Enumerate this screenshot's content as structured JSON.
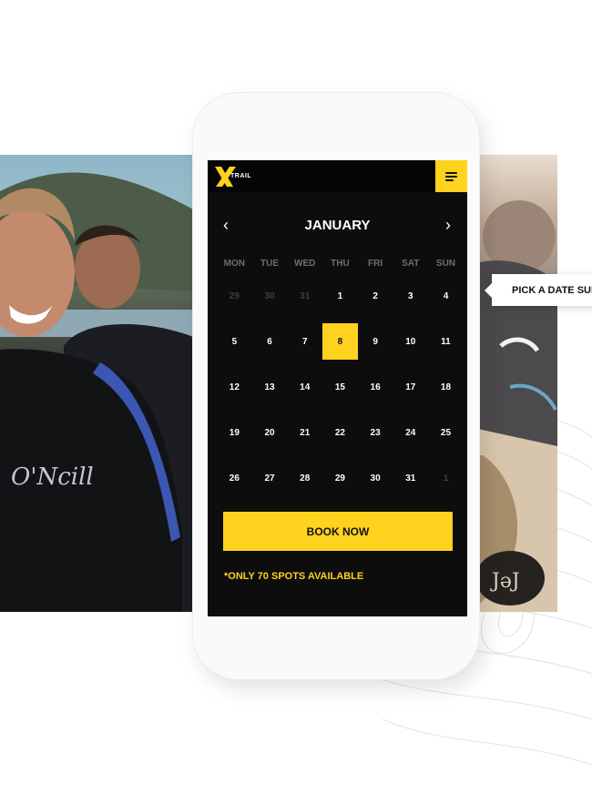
{
  "header": {
    "logo_text": "TRAIL"
  },
  "calendar": {
    "month": "JANUARY",
    "weekdays": [
      "MON",
      "TUE",
      "WED",
      "THU",
      "FRI",
      "SAT",
      "SUN"
    ],
    "days": [
      {
        "label": "29",
        "muted": true
      },
      {
        "label": "30",
        "muted": true
      },
      {
        "label": "31",
        "muted": true
      },
      {
        "label": "1"
      },
      {
        "label": "2"
      },
      {
        "label": "3"
      },
      {
        "label": "4"
      },
      {
        "label": "5"
      },
      {
        "label": "6"
      },
      {
        "label": "7"
      },
      {
        "label": "8",
        "selected": true
      },
      {
        "label": "9"
      },
      {
        "label": "10"
      },
      {
        "label": "11"
      },
      {
        "label": "12"
      },
      {
        "label": "13"
      },
      {
        "label": "14"
      },
      {
        "label": "15"
      },
      {
        "label": "16"
      },
      {
        "label": "17"
      },
      {
        "label": "18"
      },
      {
        "label": "19"
      },
      {
        "label": "20"
      },
      {
        "label": "21"
      },
      {
        "label": "22"
      },
      {
        "label": "23"
      },
      {
        "label": "24"
      },
      {
        "label": "25"
      },
      {
        "label": "26"
      },
      {
        "label": "27"
      },
      {
        "label": "28"
      },
      {
        "label": "29"
      },
      {
        "label": "30"
      },
      {
        "label": "31"
      },
      {
        "label": "1",
        "muted": true
      }
    ]
  },
  "booking": {
    "button_label": "BOOK NOW",
    "availability_note": "*ONLY 70 SPOTS AVAILABLE"
  },
  "tooltip": {
    "text": "PICK A DATE SUITS"
  },
  "colors": {
    "accent": "#ffd21f",
    "screen_bg": "#0d0d0d"
  }
}
